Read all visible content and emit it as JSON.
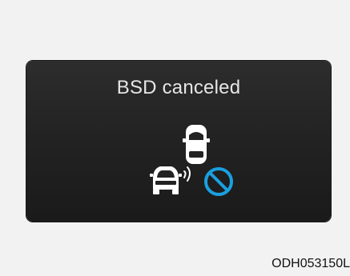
{
  "display": {
    "title": "BSD canceled",
    "icons": {
      "target_vehicle": "car-top-icon",
      "own_vehicle": "car-rear-icon",
      "signal": "radar-wave-icon",
      "status": "prohibited-icon"
    },
    "colors": {
      "background": "#222222",
      "foreground": "#ffffff",
      "status": "#1aa0e0"
    }
  },
  "figure_code": "ODH053150L"
}
